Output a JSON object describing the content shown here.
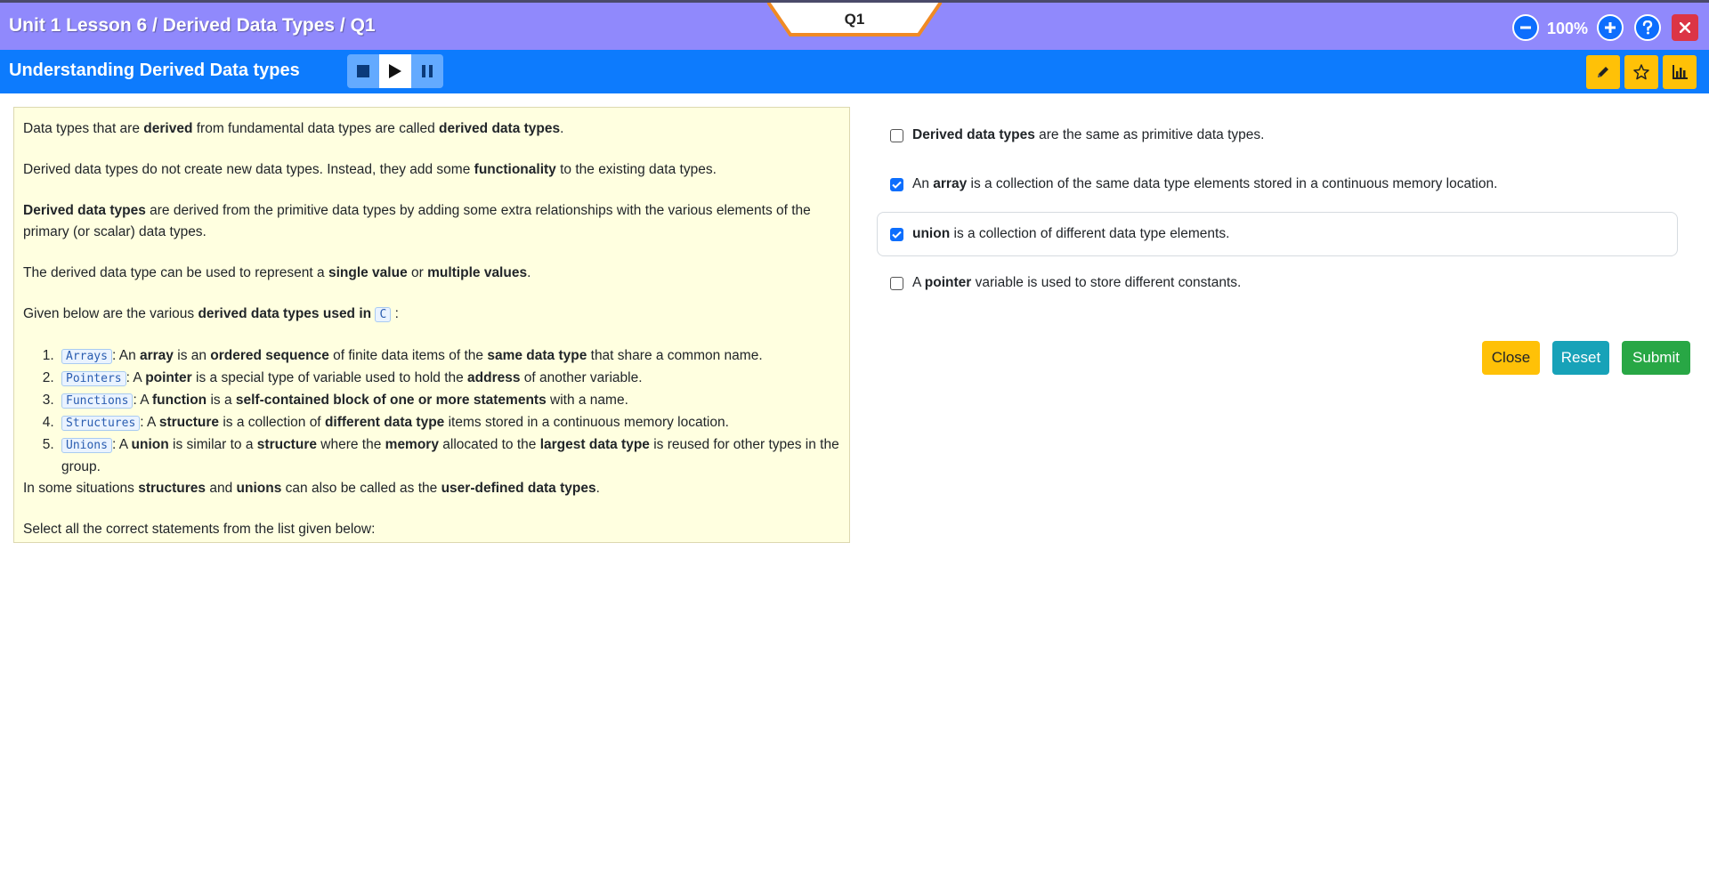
{
  "header": {
    "breadcrumb": "Unit 1 Lesson 6 / Derived Data Types / Q1",
    "question_tab": "Q1",
    "zoom": "100%",
    "colors": {
      "top_bar": "#9089fc",
      "sub_bar": "#0d7bfd",
      "tab_border": "#f08a24"
    }
  },
  "subheader": {
    "title": "Understanding Derived Data types",
    "media_controls": [
      "stop-icon",
      "play-icon",
      "pause-icon"
    ],
    "tools": [
      "pencil-icon",
      "star-icon",
      "bar-chart-icon"
    ]
  },
  "content": {
    "p1": {
      "a": "Data types that are ",
      "b": "derived",
      "c": " from fundamental data types are called ",
      "d": "derived data types",
      "e": "."
    },
    "p2": {
      "a": "Derived data types do not create new data types. Instead, they add some ",
      "b": "functionality",
      "c": " to the existing data types."
    },
    "p3": {
      "a": "Derived data types",
      "b": " are derived from the primitive data types by adding some extra relationships with the various elements of the primary (or scalar) data types."
    },
    "p4": {
      "a": "The derived data type can be used to represent a ",
      "b": "single value",
      "c": " or ",
      "d": "multiple values",
      "e": "."
    },
    "p5": {
      "a": "Given below are the various ",
      "b": "derived data types used in",
      "code": "C",
      "c": " :"
    },
    "list": [
      {
        "code": "Arrays",
        "a": ": An ",
        "b": "array",
        "c": " is an ",
        "d": "ordered sequence",
        "e": " of finite data items of the ",
        "f": "same data type",
        "g": " that share a common name."
      },
      {
        "code": "Pointers",
        "a": ": A ",
        "b": "pointer",
        "c": " is a special type of variable used to hold the ",
        "d": "address",
        "e": " of another variable."
      },
      {
        "code": "Functions",
        "a": ": A ",
        "b": "function",
        "c": " is a ",
        "d": "self-contained block of one or more statements",
        "e": " with a name."
      },
      {
        "code": "Structures",
        "a": ": A ",
        "b": "structure",
        "c": " is a collection of ",
        "d": "different data type",
        "e": " items stored in a continuous memory location."
      },
      {
        "code": "Unions",
        "a": ": A ",
        "b": "union",
        "c": " is similar to a ",
        "d": "structure",
        "e": " where the ",
        "f": "memory",
        "g": " allocated to the ",
        "h": "largest data type",
        "i": " is reused for other types in the group."
      }
    ],
    "p6": {
      "a": "In some situations ",
      "b": "structures",
      "c": " and ",
      "d": "unions",
      "e": " can also be called as the ",
      "f": "user-defined data types",
      "g": "."
    },
    "p7": "Select all the correct statements from the list given below:"
  },
  "options": [
    {
      "checked": false,
      "a": "",
      "b": "Derived data types",
      "c": " are the same as primitive data types."
    },
    {
      "checked": true,
      "a": "An ",
      "b": "array",
      "c": " is a collection of the same data type elements stored in a continuous memory location."
    },
    {
      "checked": true,
      "a": "",
      "b": "union",
      "c": " is a collection of different data type elements."
    },
    {
      "checked": false,
      "a": "A ",
      "b": "pointer",
      "c": " variable is used to store different constants."
    }
  ],
  "actions": {
    "close": "Close",
    "reset": "Reset",
    "submit": "Submit",
    "colors": {
      "close": "#ffc107",
      "reset": "#17a2b8",
      "submit": "#28a745"
    }
  }
}
